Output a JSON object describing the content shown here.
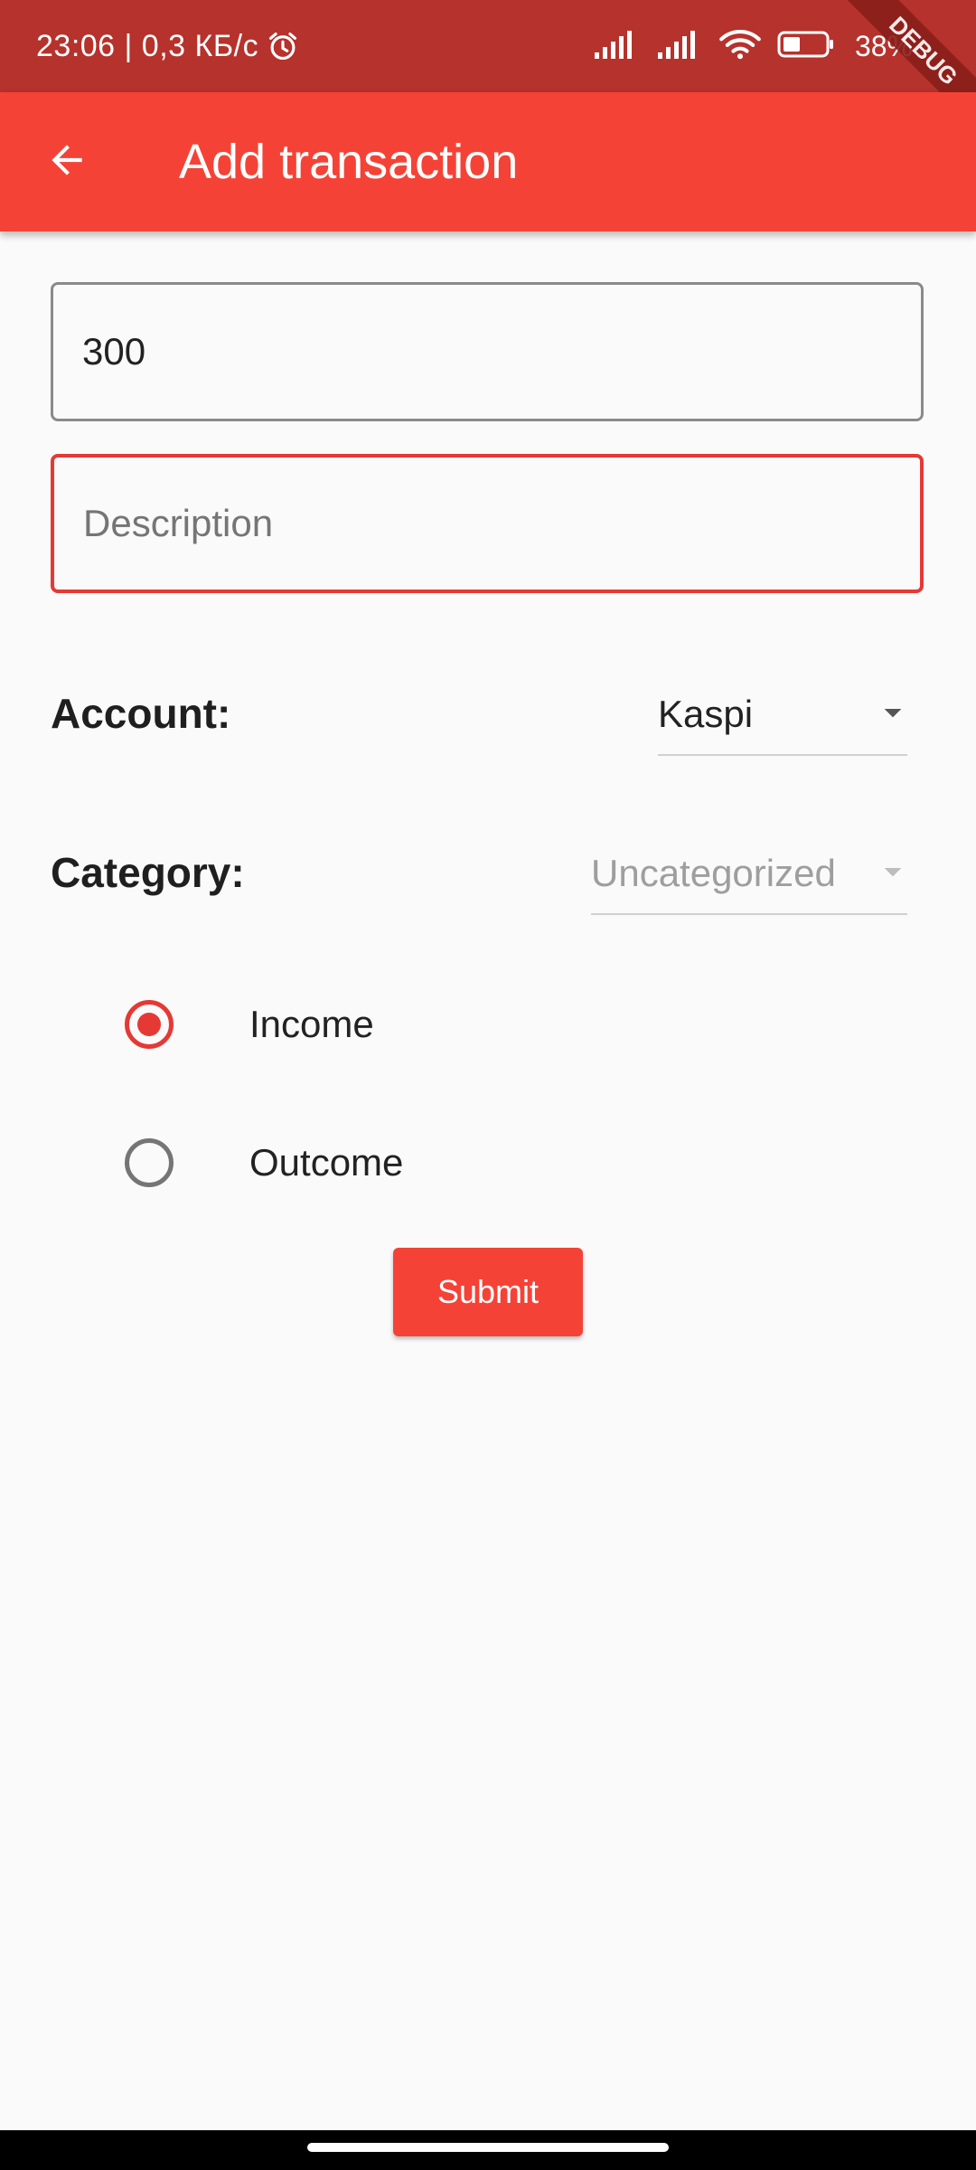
{
  "status_bar": {
    "time_speed": "23:06 | 0,3 КБ/с",
    "battery": "38%",
    "icons": [
      "alarm-icon",
      "signal-icon",
      "signal-icon",
      "wifi-icon",
      "battery-icon"
    ]
  },
  "debug_banner": "DEBUG",
  "app_bar": {
    "title": "Add transaction",
    "back_icon": "arrow-back-icon",
    "color": "#f44336"
  },
  "form": {
    "amount_value": "300",
    "description_placeholder": "Description",
    "account_label": "Account:",
    "account_value": "Kaspi",
    "category_label": "Category:",
    "category_value": "Uncategorized",
    "type_options": [
      {
        "label": "Income",
        "selected": true
      },
      {
        "label": "Outcome",
        "selected": false
      }
    ],
    "submit_label": "Submit"
  },
  "colors": {
    "accent": "#f44336",
    "status_bar": "#b6322c",
    "error_border": "#e53935"
  }
}
